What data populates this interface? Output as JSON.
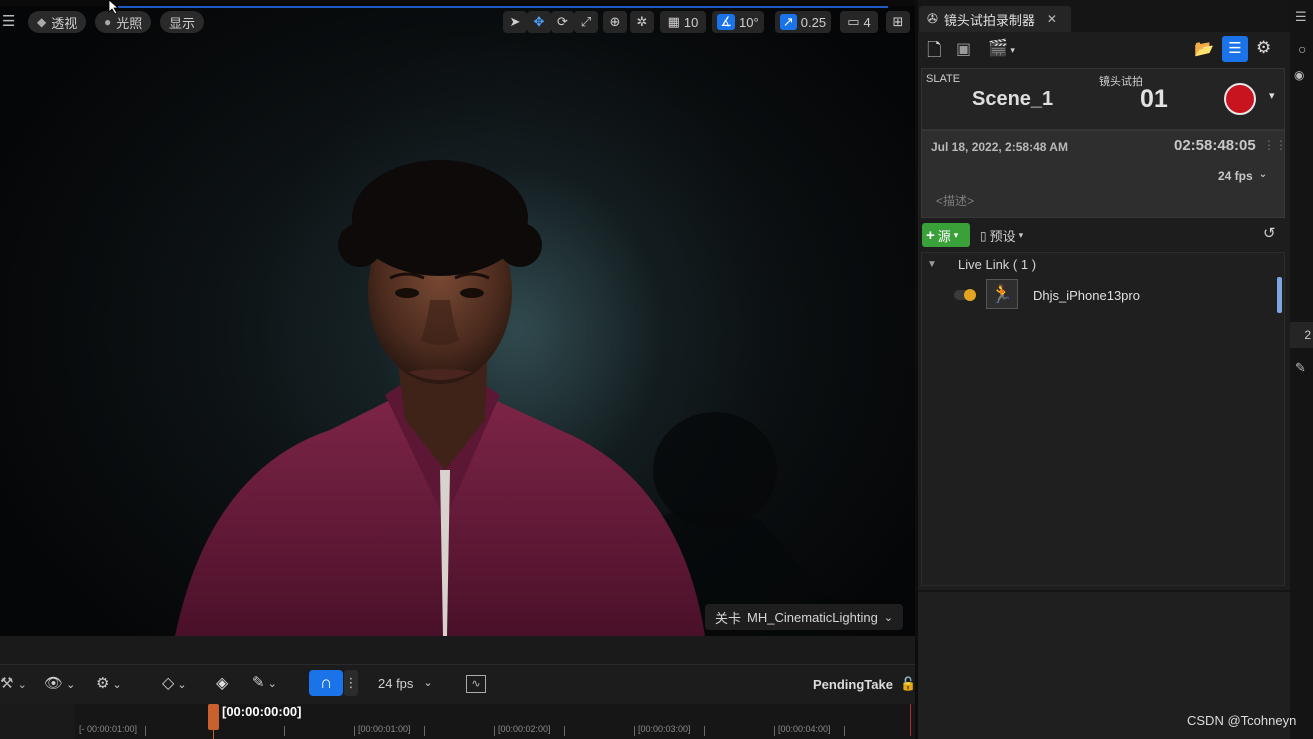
{
  "viewport": {
    "menu_icon": "hamburger-icon",
    "view_mode_label": "透视",
    "lighting_label": "光照",
    "show_label": "显示",
    "grid_value": "10",
    "angle_value": "10°",
    "scale_value": "0.25",
    "camera_speed_value": "4",
    "level_prefix": "关卡",
    "level_name": "MH_CinematicLighting"
  },
  "sequencer": {
    "fps_label": "24 fps",
    "take_name": "PendingTake",
    "current_time": "[00:00:00:00]",
    "ticks": [
      "[- 00:00:01:00]",
      "[00:00:01:00]",
      "[00:00:02:00]",
      "[00:00:03:00]",
      "[00:00:04:00]"
    ]
  },
  "panel": {
    "tab_title": "镜头试拍录制器",
    "slate_label": "SLATE",
    "slate_value": "Scene_1",
    "take_label": "镜头试拍",
    "take_value": "01",
    "date": "Jul 18, 2022, 2:58:48 AM",
    "timecode": "02:58:48:05",
    "fps": "24 fps",
    "description_placeholder": "<描述>",
    "add_source_label": "源",
    "presets_label": "预设",
    "group_label": "Live Link ( 1 )",
    "source_name": "Dhjs_iPhone13pro"
  },
  "watermark": "CSDN @Tcohneyn",
  "colors": {
    "accent_blue": "#1a73e8",
    "record_red": "#c8141e",
    "add_green": "#3aa03a",
    "jacket": "#6e1e40"
  }
}
